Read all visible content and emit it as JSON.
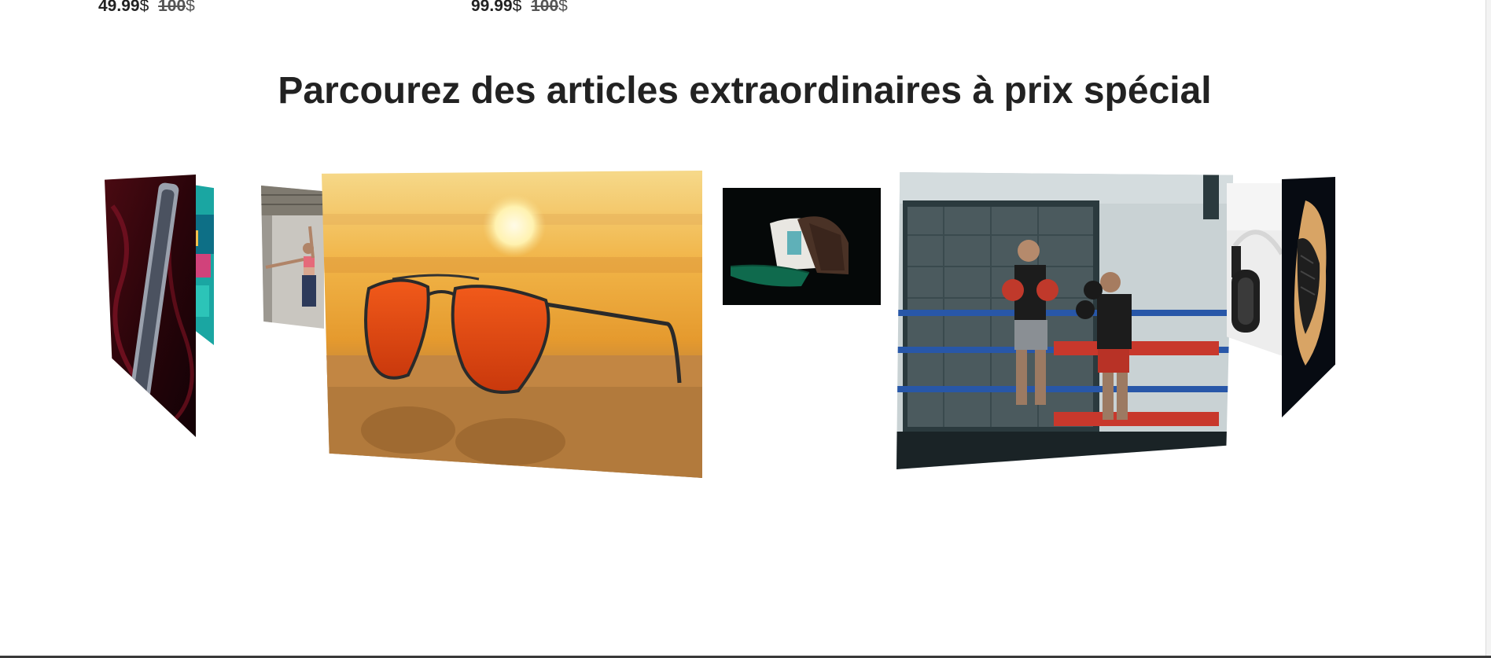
{
  "products_top": [
    {
      "price": "49.99",
      "currency": "$",
      "old_price": "100",
      "old_currency": "$"
    },
    {
      "price": "99.99",
      "currency": "$",
      "old_price": "100",
      "old_currency": "$"
    }
  ],
  "section": {
    "title": "Parcourez des articles extraordinaires à prix spécial"
  },
  "carousel": {
    "items": [
      {
        "name": "phone-case"
      },
      {
        "name": "colorful-item"
      },
      {
        "name": "fitness-woman"
      },
      {
        "name": "sunglasses-on-beach"
      },
      {
        "name": "trucker-cap"
      },
      {
        "name": "boxing-training"
      },
      {
        "name": "headphones"
      },
      {
        "name": "leather-glove"
      }
    ]
  },
  "colors": {
    "title": "#222222",
    "background": "#ffffff"
  }
}
